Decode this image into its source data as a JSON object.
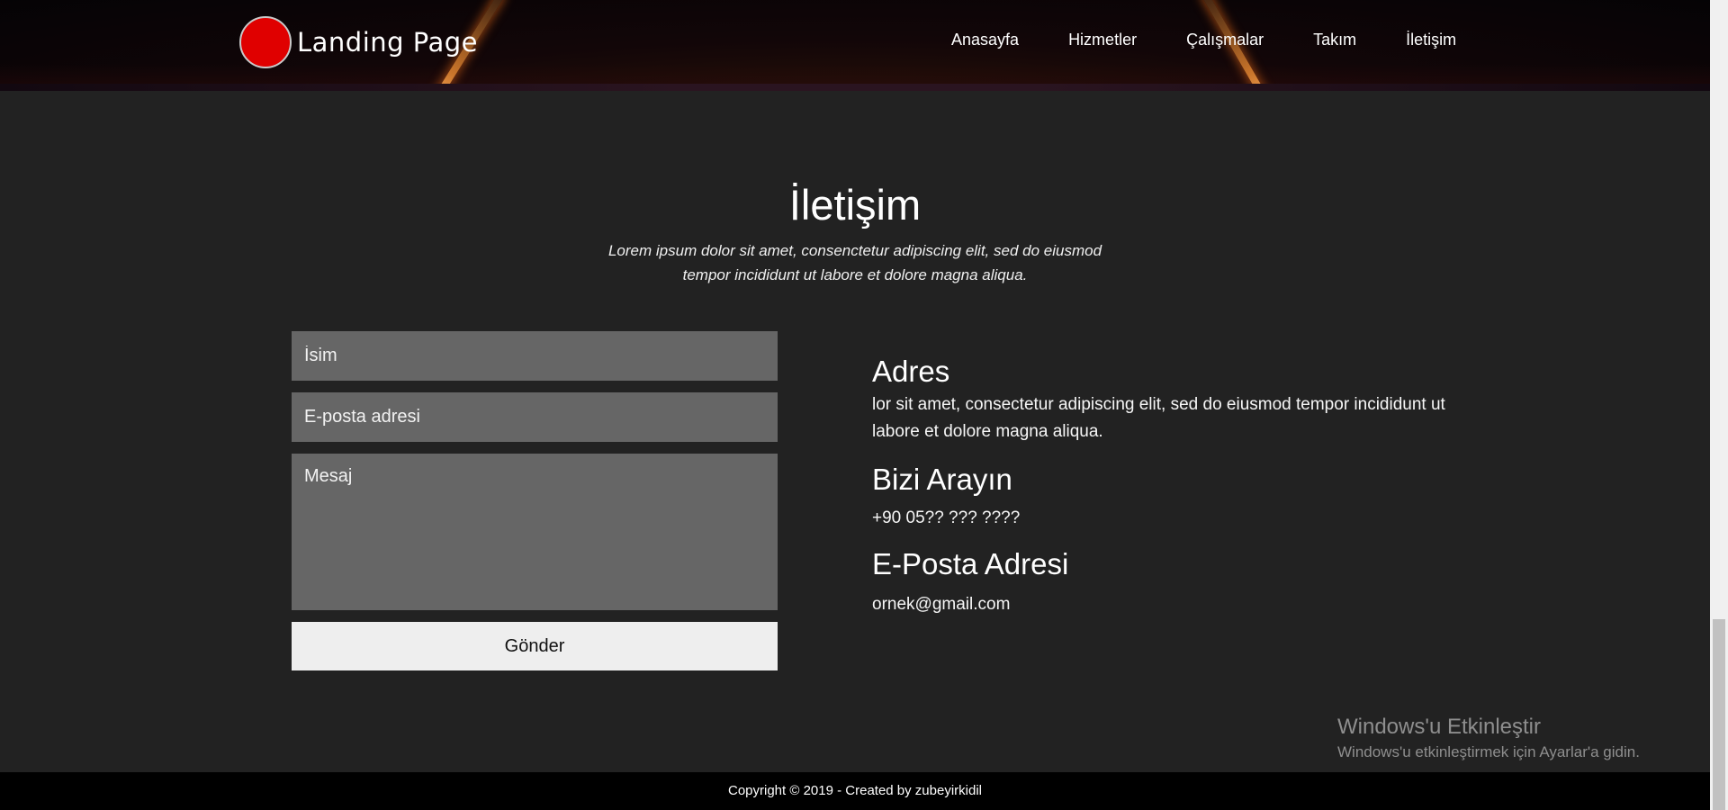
{
  "header": {
    "logo_text": "Landing Page",
    "nav": [
      "Anasayfa",
      "Hizmetler",
      "Çalışmalar",
      "Takım",
      "İletişim"
    ]
  },
  "contact": {
    "title": "İletişim",
    "subtitle": "Lorem ipsum dolor sit amet, consenctetur adipiscing elit, sed do eiusmod tempor incididunt ut labore et dolore magna aliqua.",
    "form": {
      "name_placeholder": "İsim",
      "email_placeholder": "E-posta adresi",
      "message_placeholder": "Mesaj",
      "submit_label": "Gönder"
    },
    "address_title": "Adres",
    "address_text": "lor sit amet, consectetur adipiscing elit, sed do eiusmod tempor incididunt ut labore et dolore magna aliqua.",
    "phone_title": "Bizi Arayın",
    "phone_text": "+90 05?? ??? ????",
    "email_title": "E-Posta Adresi",
    "email_text": "ornek@gmail.com"
  },
  "watermark": {
    "title": "Windows'u Etkinleştir",
    "subtitle": "Windows'u etkinleştirmek için Ayarlar'a gidin."
  },
  "footer": {
    "copyright": "Copyright © 2019 - Created by zubeyirkidil"
  },
  "colors": {
    "background": "#222222",
    "input": "#666666",
    "button": "#eeeeee",
    "logo": "#e00000",
    "footer": "#000000"
  }
}
